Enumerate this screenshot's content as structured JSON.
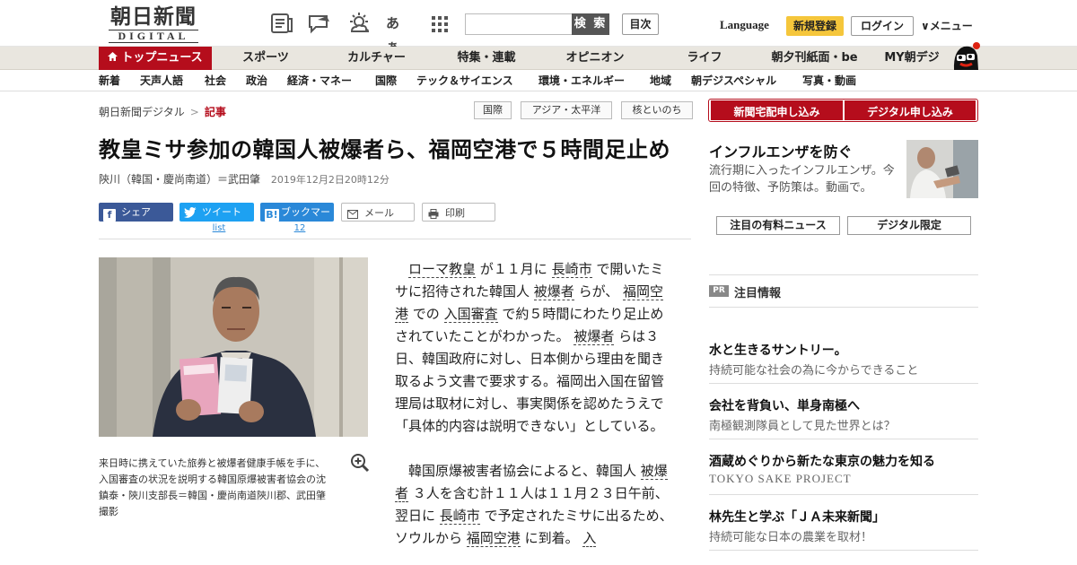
{
  "header": {
    "logo_main": "朝日新聞",
    "logo_sub": "DIGITAL",
    "search_placeholder": "",
    "search_button": "検 索",
    "toc_button": "目次",
    "language": "Language",
    "register": "新規登録",
    "login": "ログイン",
    "menu": "∨メニュー",
    "icons": [
      "news-paper-icon",
      "speech-bubble-icon",
      "weather-icon",
      "font-size-icon",
      "grid-menu-icon"
    ],
    "font_icon_text": "あぁ"
  },
  "nav": {
    "items": [
      "トップニュース",
      "スポーツ",
      "カルチャー",
      "特集・連載",
      "オピニオン",
      "ライフ",
      "朝夕刊紙面・be",
      "MY朝デジ"
    ]
  },
  "subnav": {
    "items": [
      "新着",
      "天声人語",
      "社会",
      "政治",
      "経済・マネー",
      "国際",
      "テック＆サイエンス",
      "環境・エネルギー",
      "地域",
      "朝デジスペシャル",
      "写真・動画"
    ]
  },
  "breadcrumb": {
    "home": "朝日新聞デジタル",
    "sep": ">",
    "current": "記事"
  },
  "tags": [
    "国際",
    "アジア・太平洋",
    "核といのち"
  ],
  "article": {
    "headline": "教皇ミサ参加の韓国人被爆者ら、福岡空港で５時間足止め",
    "byline": "陝川（韓国・慶尚南道）＝武田肇",
    "date": "2019年12月2日20時12分",
    "share": {
      "facebook": "シェア",
      "twitter": "ツイート",
      "hatena": "ブックマーク",
      "mail": "メール",
      "print": "印刷",
      "twitter_count": "list",
      "hatena_count": "12"
    },
    "caption": "来日時に携えていた旅券と被爆者健康手帳を手に、入国審査の状況を説明する韓国原爆被害者協会の沈鎮泰・陝川支部長＝韓国・慶尚南道陝川郡、武田肇撮影",
    "p1": {
      "s1": "ローマ教皇",
      "s2": " が１１月に ",
      "s3": "長崎市",
      "s4": " で開いたミサに招待された韓国人 ",
      "s5": "被爆者",
      "s6": " らが、 ",
      "s7": "福岡空港",
      "s8": " での ",
      "s9": "入国審査",
      "s10": " で約５時間にわたり足止めされていたことがわかった。 ",
      "s11": "被爆者",
      "s12": " らは３日、韓国政府に対し、日本側から理由を聞き取るよう文書で要求する。福岡出入国在留管理局は取材に対し、事実関係を認めたうえで「具体的内容は説明できない」としている。"
    },
    "p2": {
      "s1": "韓国原爆被害者協会によると、韓国人 ",
      "s2": "被爆者",
      "s3": " ３人を含む計１１人は１１月２３日午前、翌日に ",
      "s4": "長崎市",
      "s5": " で予定されたミサに出るため、ソウルから ",
      "s6": "福岡空港",
      "s7": " に到着。 ",
      "s8": "入"
    }
  },
  "sidebar": {
    "btn_delivery": "新聞宅配申し込み",
    "btn_digital": "デジタル申し込み",
    "promo_title": "インフルエンザを防ぐ",
    "promo_desc": "流行期に入ったインフルエンザ。今回の特徴、予防策は。動画で。",
    "tab_paid": "注目の有料ニュース",
    "tab_digital": "デジタル限定",
    "pr_badge": "PR",
    "pr_title": "注目情報",
    "ads": [
      {
        "title": "水と生きるサントリー。",
        "sub": "持続可能な社会の為に今からできること"
      },
      {
        "title": "会社を背負い、単身南極へ",
        "sub": "南極観測隊員として見た世界とは？"
      },
      {
        "title": "酒蔵めぐりから新たな東京の魅力を知る",
        "sub": "TOKYO SAKE PROJECT"
      },
      {
        "title": "林先生と学ぶ「ＪＡ未来新聞」",
        "sub": "持続可能な日本の農業を取材！"
      }
    ]
  },
  "colors": {
    "brand_red": "#b50d1c",
    "register_yellow": "#f5c63b",
    "facebook": "#3b5998",
    "twitter": "#1da1f2",
    "hatena": "#2a88d8"
  }
}
